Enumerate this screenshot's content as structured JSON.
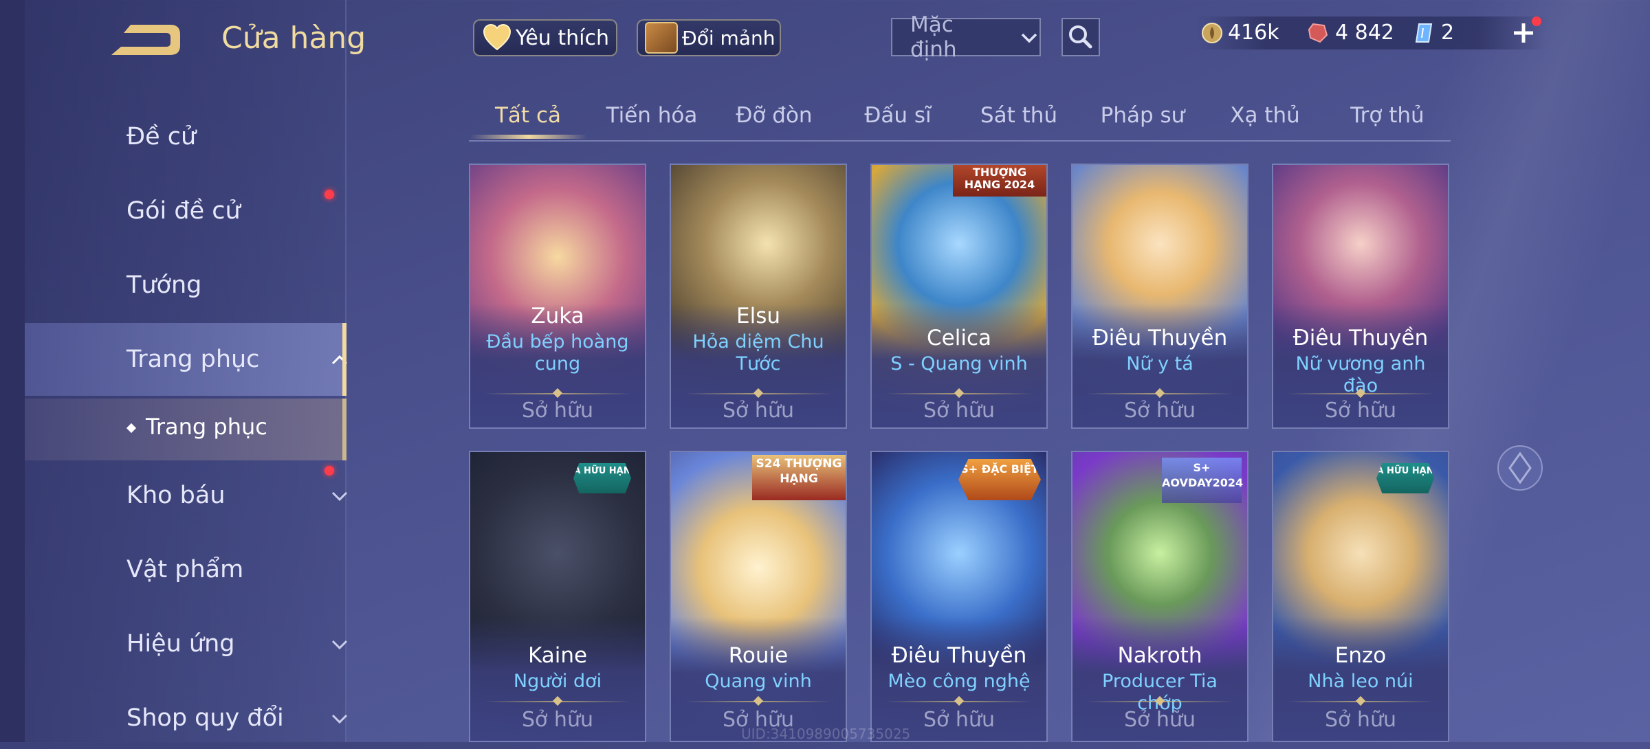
{
  "header": {
    "title": "Cửa hàng",
    "favorites_label": "Yêu thích",
    "exchange_label": "Đổi mảnh",
    "sort_value": "Mặc định"
  },
  "currencies": {
    "gold": "416k",
    "ruby": "4 842",
    "voucher": "2"
  },
  "sidebar": {
    "items": [
      {
        "label": "Đề cử"
      },
      {
        "label": "Gói đề cử"
      },
      {
        "label": "Tướng"
      },
      {
        "label": "Trang phục"
      },
      {
        "label": "Kho báu"
      },
      {
        "label": "Vật phẩm"
      },
      {
        "label": "Hiệu ứng"
      },
      {
        "label": "Shop quy đổi"
      }
    ],
    "sub_item": "Trang phục"
  },
  "tabs": [
    "Tất cả",
    "Tiến hóa",
    "Đỡ đòn",
    "Đấu sĩ",
    "Sát thủ",
    "Pháp sư",
    "Xạ thủ",
    "Trợ thủ"
  ],
  "active_tab": "Tất cả",
  "cards": [
    {
      "hero": "Zuka",
      "skin": "Đầu bếp hoàng cung",
      "status": "Sở hữu",
      "badge": ""
    },
    {
      "hero": "Elsu",
      "skin": "Hỏa diệm Chu Tước",
      "status": "Sở hữu",
      "badge": ""
    },
    {
      "hero": "Celica",
      "skin": "S - Quang vinh",
      "status": "Sở hữu",
      "badge": "THƯỢNG HẠNG 2024"
    },
    {
      "hero": "Điêu Thuyền",
      "skin": "Nữ y tá",
      "status": "Sở hữu",
      "badge": ""
    },
    {
      "hero": "Điêu Thuyền",
      "skin": "Nữ vương anh đào",
      "status": "Sở hữu",
      "badge": ""
    },
    {
      "hero": "Kaine",
      "skin": "Người dơi",
      "status": "Sở hữu",
      "badge": "A HỮU HẠN"
    },
    {
      "hero": "Rouie",
      "skin": "Quang vinh",
      "status": "Sở hữu",
      "badge": "S24 THƯỢNG HẠNG"
    },
    {
      "hero": "Điêu Thuyền",
      "skin": "Mèo công nghệ",
      "status": "Sở hữu",
      "badge": "S+ ĐẶC BIỆT"
    },
    {
      "hero": "Nakroth",
      "skin": "Producer Tia chớp",
      "status": "Sở hữu",
      "badge": "S+ AOVDAY2024"
    },
    {
      "hero": "Enzo",
      "skin": "Nhà leo núi",
      "status": "Sở hữu",
      "badge": "A HỮU HẠN"
    }
  ],
  "uid_text": "UID:3410989005735025",
  "colors": {
    "accent_gold": "#f1d9a0",
    "skin_name_blue": "#7fd1ff",
    "notification_red": "#ff3c4a"
  }
}
